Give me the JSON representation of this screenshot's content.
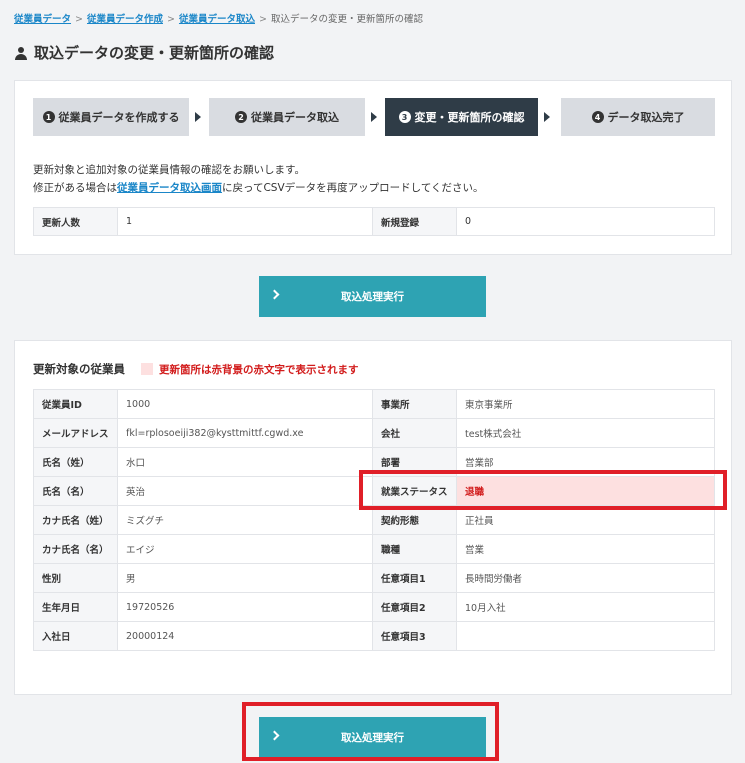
{
  "breadcrumb": {
    "items": [
      "従業員データ",
      "従業員データ作成",
      "従業員データ取込"
    ],
    "current": "取込データの変更・更新箇所の確認",
    "separator": ">"
  },
  "page": {
    "title": "取込データの変更・更新箇所の確認"
  },
  "steps": [
    {
      "num": "1",
      "label": "従業員データを作成する",
      "active": false
    },
    {
      "num": "2",
      "label": "従業員データ取込",
      "active": false
    },
    {
      "num": "3",
      "label": "変更・更新箇所の確認",
      "active": true
    },
    {
      "num": "4",
      "label": "データ取込完了",
      "active": false
    }
  ],
  "info": {
    "line1": "更新対象と追加対象の従業員情報の確認をお願いします。",
    "line2_pre": "修正がある場合は",
    "line2_link": "従業員データ取込画面",
    "line2_post": "に戻ってCSVデータを再度アップロードしてください。"
  },
  "summary": {
    "update_label": "更新人数",
    "update_value": "1",
    "new_label": "新規登録",
    "new_value": "0"
  },
  "execute_button": "取込処理実行",
  "employee_section": {
    "title": "更新対象の従業員",
    "legend": "更新箇所は赤背景の赤文字で表示されます",
    "rows": [
      {
        "l1": "従業員ID",
        "v1": "1000",
        "l2": "事業所",
        "v2": "東京事業所"
      },
      {
        "l1": "メールアドレス",
        "v1": "fkl=rplosoeiji382@kysttmittf.cgwd.xe",
        "l2": "会社",
        "v2": "test株式会社"
      },
      {
        "l1": "氏名（姓）",
        "v1": "水口",
        "l2": "部署",
        "v2": "営業部"
      },
      {
        "l1": "氏名（名）",
        "v1": "英治",
        "l2": "就業ステータス",
        "v2": "退職"
      },
      {
        "l1": "カナ氏名（姓）",
        "v1": "ミズグチ",
        "l2": "契約形態",
        "v2": "正社員"
      },
      {
        "l1": "カナ氏名（名）",
        "v1": "エイジ",
        "l2": "職種",
        "v2": "営業"
      },
      {
        "l1": "性別",
        "v1": "男",
        "l2": "任意項目1",
        "v2": "長時間労働者"
      },
      {
        "l1": "生年月日",
        "v1": "19720526",
        "l2": "任意項目2",
        "v2": "10月入社"
      },
      {
        "l1": "入社日",
        "v1": "20000124",
        "l2": "任意項目3",
        "v2": ""
      }
    ]
  },
  "colors": {
    "accent": "#2ea3b3",
    "active_step": "#2f3c47",
    "changed_bg": "#fde0e0",
    "changed_text": "#d21c1c",
    "annotation_box": "#e01f28"
  }
}
